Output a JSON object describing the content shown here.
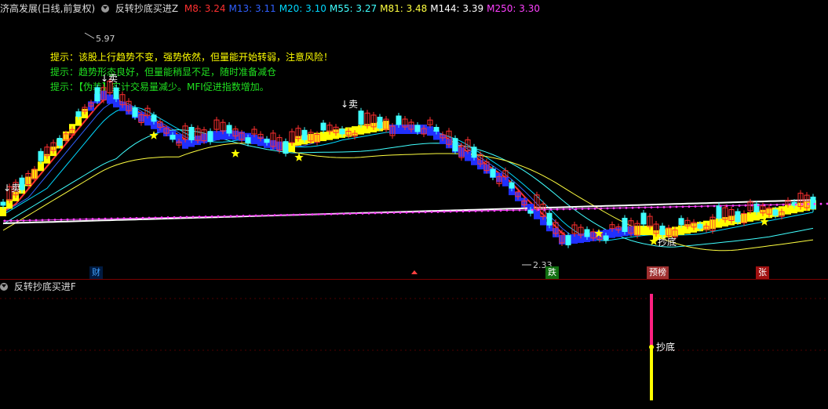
{
  "main": {
    "stock": "济高发展(日线,前复权)",
    "indicator": "反转抄底买进Z",
    "mas": [
      {
        "label": "M8: 3.24",
        "color": "#ff3030"
      },
      {
        "label": "M13: 3.11",
        "color": "#3060ff"
      },
      {
        "label": "M20: 3.10",
        "color": "#00d8ff"
      },
      {
        "label": "M55: 3.27",
        "color": "#40ffff"
      },
      {
        "label": "M81: 3.48",
        "color": "#ffff40"
      },
      {
        "label": "M144: 3.39",
        "color": "#ffffff"
      },
      {
        "label": "M250: 3.30",
        "color": "#ff40ff"
      }
    ],
    "tips": [
      {
        "text": "提示：该股上行趋势不变，强势依然，但量能开始转弱，注意风险！",
        "color": "#ffff00"
      },
      {
        "text": "提示：趋势形态良好，但量能稍显不足，随时准备减仓",
        "color": "#20e020"
      },
      {
        "text": "提示：【伪装】实计交易量减少。MFI促进指数增加。",
        "color": "#20e020"
      }
    ],
    "high_label": "5.97",
    "low_label": "2.33",
    "sell_labels": [
      "↓卖",
      "↓卖",
      "↓卖"
    ],
    "bottom_label": "抄底",
    "badges": [
      {
        "text": "财",
        "color": "#40a0ff",
        "bg": "#001a40"
      },
      {
        "text": "跌",
        "color": "#ffffff",
        "bg": "#107010"
      },
      {
        "text": "预榜",
        "color": "#ffffff",
        "bg": "#a03030"
      },
      {
        "text": "张",
        "color": "#ffffff",
        "bg": "#a01010"
      }
    ]
  },
  "sub": {
    "indicator": "反转抄底买进F",
    "signal_label": "抄底"
  }
}
